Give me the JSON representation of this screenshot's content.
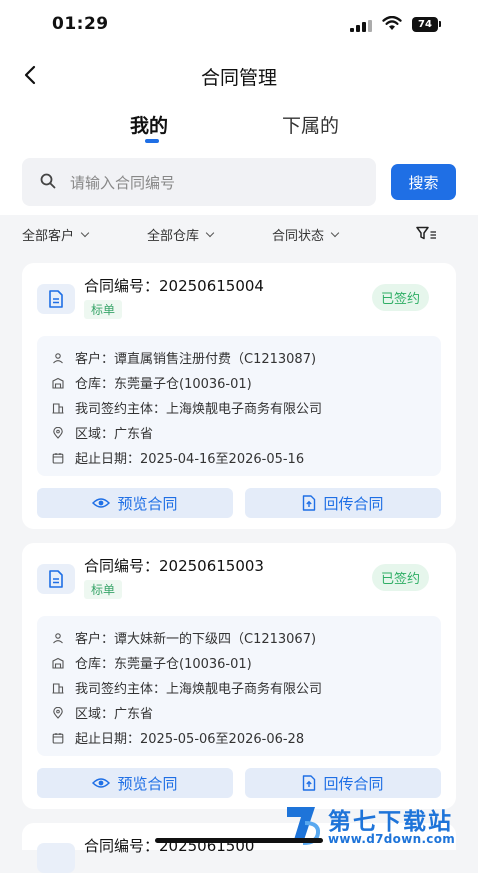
{
  "status_bar": {
    "time": "01:29",
    "battery": "74"
  },
  "header": {
    "title": "合同管理"
  },
  "tabs": [
    {
      "label": "我的",
      "active": true
    },
    {
      "label": "下属的",
      "active": false
    }
  ],
  "search": {
    "placeholder": "请输入合同编号",
    "value": "",
    "button_label": "搜索"
  },
  "filters": [
    {
      "label": "全部客户"
    },
    {
      "label": "全部仓库"
    },
    {
      "label": "合同状态"
    }
  ],
  "colors": {
    "accent": "#1f6fe5",
    "status_green": "#2fae65",
    "card_bg": "#ffffff",
    "page_bg": "#f4f5f7"
  },
  "contracts": [
    {
      "contract_no": "合同编号：20250615004",
      "tag": "标单",
      "status": "已签约",
      "customer": "客户：谭直属销售注册付费（C1213087)",
      "warehouse": "仓库：东莞量子仓(10036-01)",
      "entity": "我司签约主体：上海焕靓电子商务有限公司",
      "region": "区域：广东省",
      "date": "起止日期：2025-04-16至2026-05-16",
      "preview_label": "预览合同",
      "return_label": "回传合同"
    },
    {
      "contract_no": "合同编号：20250615003",
      "tag": "标单",
      "status": "已签约",
      "customer": "客户：谭大妹新一的下级四（C1213067)",
      "warehouse": "仓库：东莞量子仓(10036-01)",
      "entity": "我司签约主体：上海焕靓电子商务有限公司",
      "region": "区域：广东省",
      "date": "起止日期：2025-05-06至2026-06-28",
      "preview_label": "预览合同",
      "return_label": "回传合同"
    },
    {
      "contract_no": "合同编号：2025061500"
    }
  ],
  "watermark": {
    "name": "第七下载站",
    "url": "www.d7down.com"
  }
}
